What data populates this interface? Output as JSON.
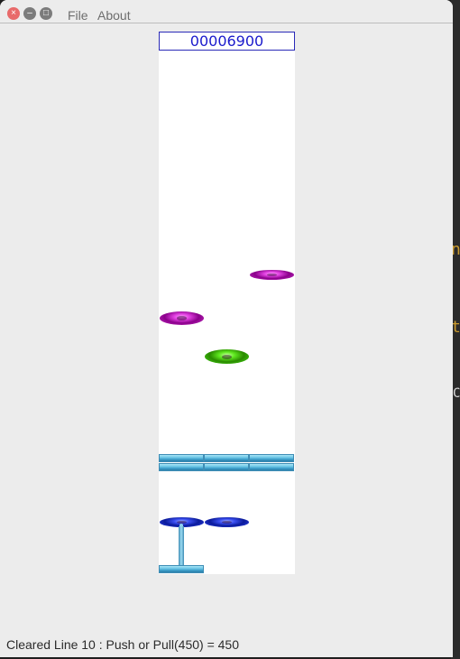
{
  "window": {
    "close_glyph": "×",
    "minimize_glyph": "–",
    "maximize_glyph": "□"
  },
  "menu": {
    "file_label": "File",
    "about_label": "About"
  },
  "game": {
    "score": "00006900",
    "pieces": [
      {
        "kind": "ring",
        "color": "magenta"
      },
      {
        "kind": "ring",
        "color": "magenta"
      },
      {
        "kind": "ring",
        "color": "green"
      },
      {
        "kind": "ring",
        "color": "blue"
      },
      {
        "kind": "ring",
        "color": "blue"
      }
    ],
    "colors": {
      "magenta": "#c020c0",
      "green": "#3cbc10",
      "blue": "#1a2ad0",
      "brick": "#6cc6e6",
      "score_text": "#1a1acc"
    }
  },
  "status": {
    "message": "Cleared Line 10 : Push or Pull(450) = 450"
  },
  "background": {
    "fragment_1": "n",
    "fragment_2": "t",
    "fragment_3": "C"
  }
}
